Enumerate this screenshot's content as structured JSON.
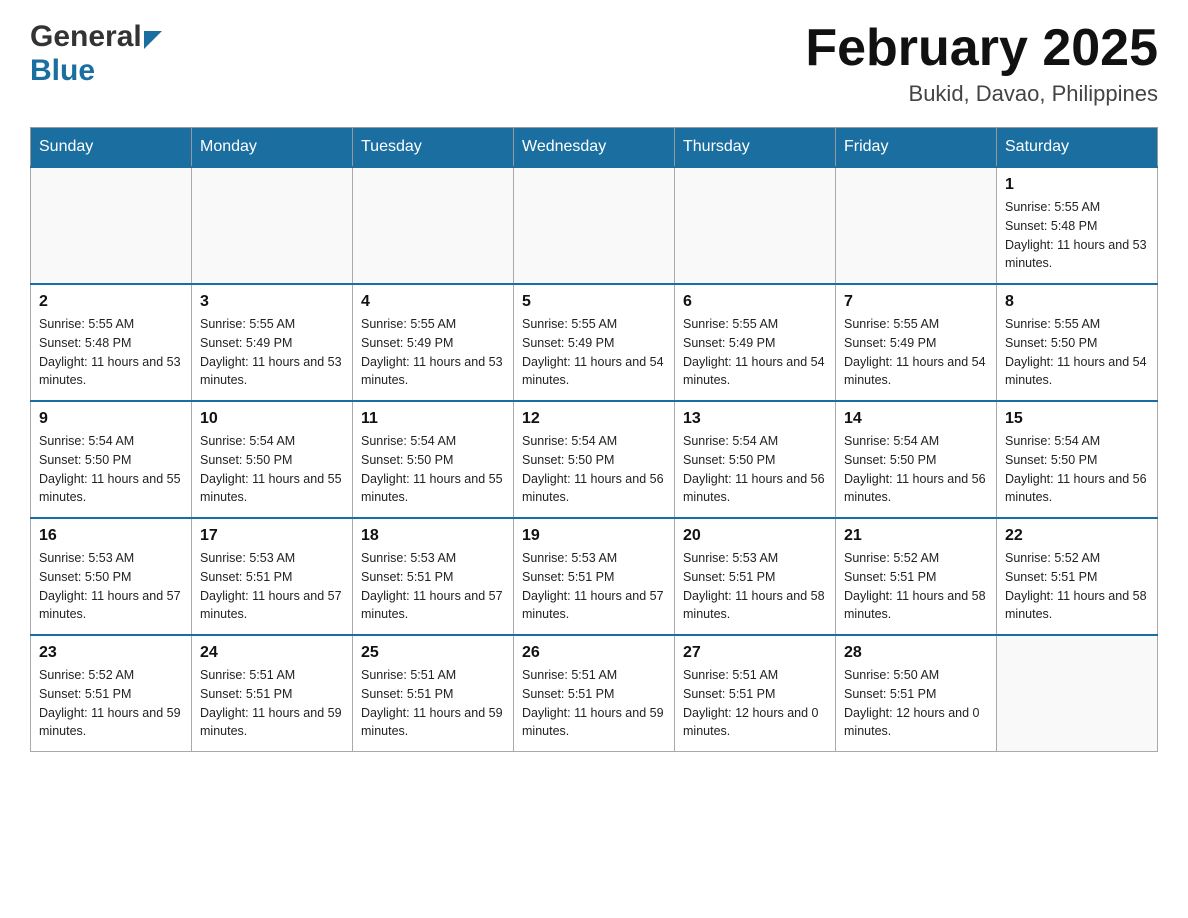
{
  "header": {
    "logo_general": "General",
    "logo_blue": "Blue",
    "month_title": "February 2025",
    "location": "Bukid, Davao, Philippines"
  },
  "weekdays": [
    "Sunday",
    "Monday",
    "Tuesday",
    "Wednesday",
    "Thursday",
    "Friday",
    "Saturday"
  ],
  "weeks": [
    [
      {
        "day": "",
        "sunrise": "",
        "sunset": "",
        "daylight": "",
        "empty": true
      },
      {
        "day": "",
        "sunrise": "",
        "sunset": "",
        "daylight": "",
        "empty": true
      },
      {
        "day": "",
        "sunrise": "",
        "sunset": "",
        "daylight": "",
        "empty": true
      },
      {
        "day": "",
        "sunrise": "",
        "sunset": "",
        "daylight": "",
        "empty": true
      },
      {
        "day": "",
        "sunrise": "",
        "sunset": "",
        "daylight": "",
        "empty": true
      },
      {
        "day": "",
        "sunrise": "",
        "sunset": "",
        "daylight": "",
        "empty": true
      },
      {
        "day": "1",
        "sunrise": "Sunrise: 5:55 AM",
        "sunset": "Sunset: 5:48 PM",
        "daylight": "Daylight: 11 hours and 53 minutes.",
        "empty": false
      }
    ],
    [
      {
        "day": "2",
        "sunrise": "Sunrise: 5:55 AM",
        "sunset": "Sunset: 5:48 PM",
        "daylight": "Daylight: 11 hours and 53 minutes.",
        "empty": false
      },
      {
        "day": "3",
        "sunrise": "Sunrise: 5:55 AM",
        "sunset": "Sunset: 5:49 PM",
        "daylight": "Daylight: 11 hours and 53 minutes.",
        "empty": false
      },
      {
        "day": "4",
        "sunrise": "Sunrise: 5:55 AM",
        "sunset": "Sunset: 5:49 PM",
        "daylight": "Daylight: 11 hours and 53 minutes.",
        "empty": false
      },
      {
        "day": "5",
        "sunrise": "Sunrise: 5:55 AM",
        "sunset": "Sunset: 5:49 PM",
        "daylight": "Daylight: 11 hours and 54 minutes.",
        "empty": false
      },
      {
        "day": "6",
        "sunrise": "Sunrise: 5:55 AM",
        "sunset": "Sunset: 5:49 PM",
        "daylight": "Daylight: 11 hours and 54 minutes.",
        "empty": false
      },
      {
        "day": "7",
        "sunrise": "Sunrise: 5:55 AM",
        "sunset": "Sunset: 5:49 PM",
        "daylight": "Daylight: 11 hours and 54 minutes.",
        "empty": false
      },
      {
        "day": "8",
        "sunrise": "Sunrise: 5:55 AM",
        "sunset": "Sunset: 5:50 PM",
        "daylight": "Daylight: 11 hours and 54 minutes.",
        "empty": false
      }
    ],
    [
      {
        "day": "9",
        "sunrise": "Sunrise: 5:54 AM",
        "sunset": "Sunset: 5:50 PM",
        "daylight": "Daylight: 11 hours and 55 minutes.",
        "empty": false
      },
      {
        "day": "10",
        "sunrise": "Sunrise: 5:54 AM",
        "sunset": "Sunset: 5:50 PM",
        "daylight": "Daylight: 11 hours and 55 minutes.",
        "empty": false
      },
      {
        "day": "11",
        "sunrise": "Sunrise: 5:54 AM",
        "sunset": "Sunset: 5:50 PM",
        "daylight": "Daylight: 11 hours and 55 minutes.",
        "empty": false
      },
      {
        "day": "12",
        "sunrise": "Sunrise: 5:54 AM",
        "sunset": "Sunset: 5:50 PM",
        "daylight": "Daylight: 11 hours and 56 minutes.",
        "empty": false
      },
      {
        "day": "13",
        "sunrise": "Sunrise: 5:54 AM",
        "sunset": "Sunset: 5:50 PM",
        "daylight": "Daylight: 11 hours and 56 minutes.",
        "empty": false
      },
      {
        "day": "14",
        "sunrise": "Sunrise: 5:54 AM",
        "sunset": "Sunset: 5:50 PM",
        "daylight": "Daylight: 11 hours and 56 minutes.",
        "empty": false
      },
      {
        "day": "15",
        "sunrise": "Sunrise: 5:54 AM",
        "sunset": "Sunset: 5:50 PM",
        "daylight": "Daylight: 11 hours and 56 minutes.",
        "empty": false
      }
    ],
    [
      {
        "day": "16",
        "sunrise": "Sunrise: 5:53 AM",
        "sunset": "Sunset: 5:50 PM",
        "daylight": "Daylight: 11 hours and 57 minutes.",
        "empty": false
      },
      {
        "day": "17",
        "sunrise": "Sunrise: 5:53 AM",
        "sunset": "Sunset: 5:51 PM",
        "daylight": "Daylight: 11 hours and 57 minutes.",
        "empty": false
      },
      {
        "day": "18",
        "sunrise": "Sunrise: 5:53 AM",
        "sunset": "Sunset: 5:51 PM",
        "daylight": "Daylight: 11 hours and 57 minutes.",
        "empty": false
      },
      {
        "day": "19",
        "sunrise": "Sunrise: 5:53 AM",
        "sunset": "Sunset: 5:51 PM",
        "daylight": "Daylight: 11 hours and 57 minutes.",
        "empty": false
      },
      {
        "day": "20",
        "sunrise": "Sunrise: 5:53 AM",
        "sunset": "Sunset: 5:51 PM",
        "daylight": "Daylight: 11 hours and 58 minutes.",
        "empty": false
      },
      {
        "day": "21",
        "sunrise": "Sunrise: 5:52 AM",
        "sunset": "Sunset: 5:51 PM",
        "daylight": "Daylight: 11 hours and 58 minutes.",
        "empty": false
      },
      {
        "day": "22",
        "sunrise": "Sunrise: 5:52 AM",
        "sunset": "Sunset: 5:51 PM",
        "daylight": "Daylight: 11 hours and 58 minutes.",
        "empty": false
      }
    ],
    [
      {
        "day": "23",
        "sunrise": "Sunrise: 5:52 AM",
        "sunset": "Sunset: 5:51 PM",
        "daylight": "Daylight: 11 hours and 59 minutes.",
        "empty": false
      },
      {
        "day": "24",
        "sunrise": "Sunrise: 5:51 AM",
        "sunset": "Sunset: 5:51 PM",
        "daylight": "Daylight: 11 hours and 59 minutes.",
        "empty": false
      },
      {
        "day": "25",
        "sunrise": "Sunrise: 5:51 AM",
        "sunset": "Sunset: 5:51 PM",
        "daylight": "Daylight: 11 hours and 59 minutes.",
        "empty": false
      },
      {
        "day": "26",
        "sunrise": "Sunrise: 5:51 AM",
        "sunset": "Sunset: 5:51 PM",
        "daylight": "Daylight: 11 hours and 59 minutes.",
        "empty": false
      },
      {
        "day": "27",
        "sunrise": "Sunrise: 5:51 AM",
        "sunset": "Sunset: 5:51 PM",
        "daylight": "Daylight: 12 hours and 0 minutes.",
        "empty": false
      },
      {
        "day": "28",
        "sunrise": "Sunrise: 5:50 AM",
        "sunset": "Sunset: 5:51 PM",
        "daylight": "Daylight: 12 hours and 0 minutes.",
        "empty": false
      },
      {
        "day": "",
        "sunrise": "",
        "sunset": "",
        "daylight": "",
        "empty": true
      }
    ]
  ]
}
